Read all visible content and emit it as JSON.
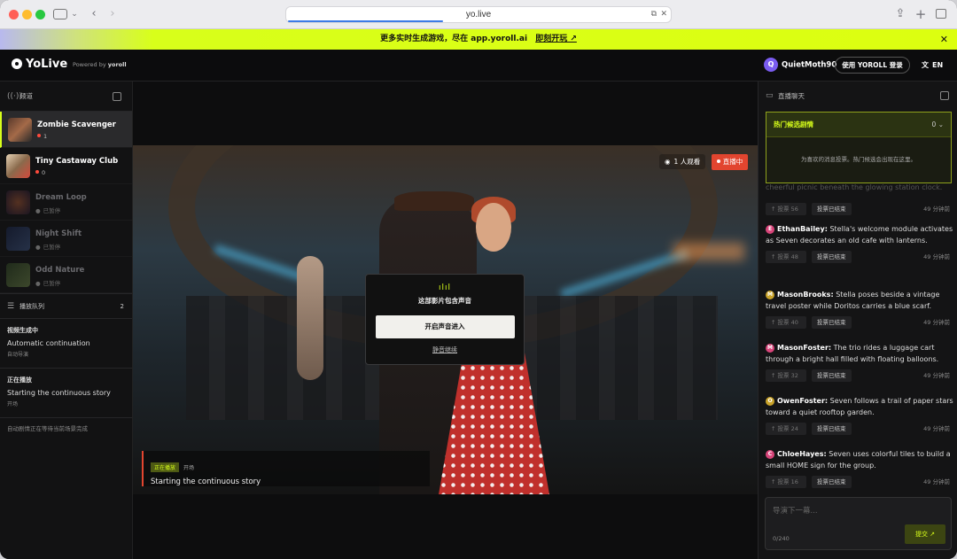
{
  "browser": {
    "url": "yo.live",
    "translate_icon": "translate-icon",
    "close_tab_glyph": "✕"
  },
  "banner": {
    "text": "更多实时生成游戏，尽在 app.yoroll.ai",
    "cta": "即刻开玩 ↗",
    "close": "✕"
  },
  "header": {
    "brand": "YoLive",
    "powered_prefix": "Powered by",
    "powered_brand": "yoroll",
    "user_initial": "Q",
    "user_name": "QuietMoth90",
    "login_label": "使用 YOROLL 登录",
    "lang_label": "EN"
  },
  "sidebar": {
    "title": "频道",
    "channels": [
      {
        "name": "Zombie Scavenger",
        "status": "1"
      },
      {
        "name": "Tiny Castaway Club",
        "status": "0"
      },
      {
        "name": "Dream Loop",
        "status": "已暂停"
      },
      {
        "name": "Night Shift",
        "status": "已暂停"
      },
      {
        "name": "Odd Nature",
        "status": "已暂停"
      }
    ],
    "queue": {
      "title": "播放队列",
      "count": "2",
      "items": [
        {
          "state": "视频生成中",
          "title": "Automatic continuation",
          "sub": "自动导演"
        },
        {
          "state": "正在播放",
          "title": "Starting the continuous story",
          "sub": "开场"
        }
      ],
      "footer": "自动剧情正在等待当前场景完成"
    }
  },
  "player": {
    "viewers": "1 人观看",
    "live": "直播中",
    "modal": {
      "icon": "ılıl",
      "title": "这部影片包含声音",
      "enter": "开启声音进入",
      "mute": "静音继续"
    },
    "now_playing": {
      "tag": "正在播放",
      "sub": "开场",
      "title": "Starting the continuous story"
    }
  },
  "chat": {
    "title": "直播聊天",
    "hot": {
      "title": "热门候选剧情",
      "count": "0",
      "empty": "为喜欢的消息投票。热门候选会出现在这里。"
    },
    "peek_text": "cheerful picnic beneath the glowing station clock.",
    "peek_votes": "56",
    "peek_ended": "投票已结束",
    "peek_time": "49 分钟前",
    "messages": [
      {
        "initial": "E",
        "color": "#d8457a",
        "user": "EthanBailey",
        "text": "Stella's welcome module activates as Seven decorates an old cafe with lanterns.",
        "votes": "48",
        "ended": "投票已结束",
        "time": "49 分钟前"
      },
      {
        "initial": "M",
        "color": "#c9a32a",
        "user": "MasonBrooks",
        "text": "Stella poses beside a vintage travel poster while Doritos carries a blue scarf.",
        "votes": "40",
        "ended": "投票已结束",
        "time": "49 分钟前"
      },
      {
        "initial": "M",
        "color": "#d8457a",
        "user": "MasonFoster",
        "text": "The trio rides a luggage cart through a bright hall filled with floating balloons.",
        "votes": "32",
        "ended": "投票已结束",
        "time": "49 分钟前"
      },
      {
        "initial": "O",
        "color": "#c9a32a",
        "user": "OwenFoster",
        "text": "Seven follows a trail of paper stars toward a quiet rooftop garden.",
        "votes": "24",
        "ended": "投票已结束",
        "time": "49 分钟前"
      },
      {
        "initial": "C",
        "color": "#d8457a",
        "user": "ChloeHayes",
        "text": "Seven uses colorful tiles to build a small HOME sign for the group.",
        "votes": "16",
        "ended": "投票已结束",
        "time": "49 分钟前"
      }
    ],
    "vote_label": "投票",
    "input_placeholder": "导演下一幕...",
    "counter": "0/240",
    "submit": "提交 ↗"
  }
}
